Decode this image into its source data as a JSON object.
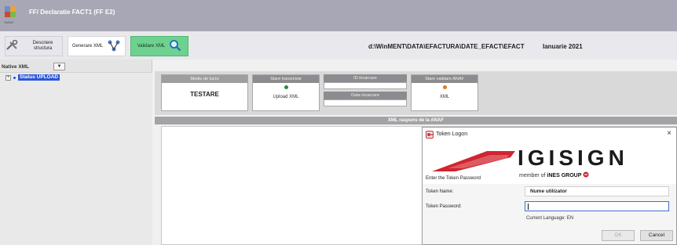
{
  "window": {
    "title": "FF/ Declaratie FACT1 (FF E2)",
    "icon_caption": "SMIMT"
  },
  "toolbar": {
    "descriere_label": "Descriere structura",
    "generare_label": "Generare XML",
    "validare_label": "Validare XML",
    "path": "d:\\WinMENT\\DATA\\EFACTURA\\DATE_EFACT\\EFACT",
    "period": "Ianuarie 2021"
  },
  "left_panel": {
    "combo_label": "Native XML",
    "combo_arrow": "▼",
    "tree": [
      {
        "expander": "+",
        "label": "Status UPLOAD"
      }
    ]
  },
  "status": {
    "mediu_header": "Mediu de lucru",
    "mediu_value": "TESTARE",
    "transmisie_header": "Stare transmisie",
    "upload_label": "Upload XML",
    "id_header": "ID incarcare",
    "data_header": "Data incarcare",
    "anaf_header": "Stare validare ANAF",
    "anaf_label": "XML"
  },
  "response": {
    "header": "XML raspuns de la ANAF"
  },
  "dialog": {
    "title": "Token Logon",
    "close": "×",
    "logo_text": "IGISIGN",
    "logo_sub_prefix": "member of",
    "logo_sub_group": "iNES GROUP",
    "enter_password": "Enter the Token Password",
    "token_name_label": "Token Name:",
    "token_name_value": "Nume utilizator",
    "token_password_label": "Token Password:",
    "current_language": "Current Language:  EN",
    "ok_label": "OK",
    "cancel_label": "Cancel"
  },
  "colors": {
    "titlebar": "#a7a7b5",
    "validare_green": "#6fd190",
    "tree_selection": "#2b56d8",
    "igisign_red": "#d1242f"
  }
}
